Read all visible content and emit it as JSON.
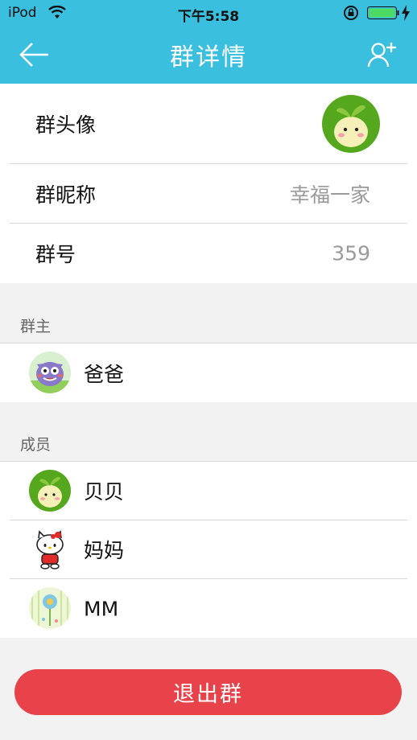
{
  "status_bar": {
    "carrier": "iPod",
    "time": "下午5:58"
  },
  "nav": {
    "title": "群详情",
    "back_icon": "arrow-left-icon",
    "add_icon": "add-user-icon"
  },
  "group_info": {
    "avatar_label": "群头像",
    "nickname_label": "群昵称",
    "nickname_value": "幸福一家",
    "number_label": "群号",
    "number_value": "359"
  },
  "owner_section": {
    "title": "群主",
    "owner": {
      "name": "爸爸",
      "avatar": "monster-avatar"
    }
  },
  "members_section": {
    "title": "成员",
    "members": [
      {
        "name": "贝贝",
        "avatar": "sprout-avatar"
      },
      {
        "name": "妈妈",
        "avatar": "kitty-avatar"
      },
      {
        "name": "MM",
        "avatar": "flower-avatar"
      }
    ]
  },
  "actions": {
    "exit_label": "退出群"
  },
  "colors": {
    "header": "#3bbfdf",
    "exit_button": "#e8434a",
    "background": "#f2f2f2"
  }
}
